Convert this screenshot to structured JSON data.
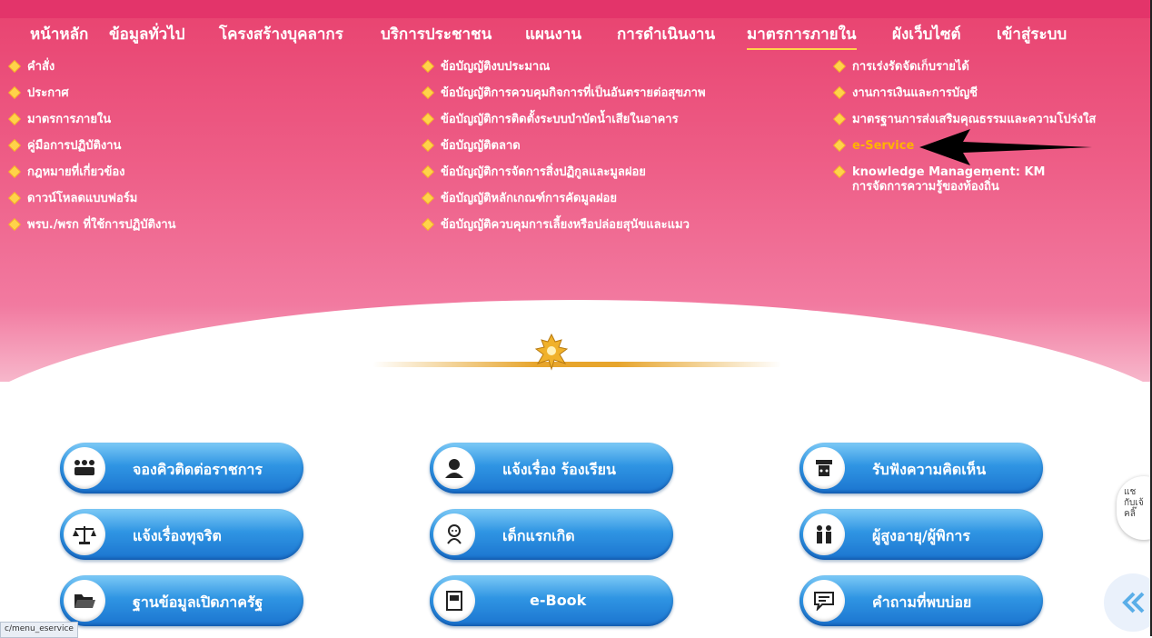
{
  "nav": [
    {
      "label": "หน้าหลัก",
      "active": false
    },
    {
      "label": "ข้อมูลทั่วไป",
      "active": false
    },
    {
      "label": "โครงสร้างบุคลากร",
      "active": false
    },
    {
      "label": "บริการประชาชน",
      "active": false
    },
    {
      "label": "แผนงาน",
      "active": false
    },
    {
      "label": "การดำเนินงาน",
      "active": false
    },
    {
      "label": "มาตรการภายใน",
      "active": true
    },
    {
      "label": "ผังเว็บไซต์",
      "active": false
    },
    {
      "label": "เข้าสู่ระบบ",
      "active": false
    }
  ],
  "submenu": {
    "col1": [
      "คำสั่ง",
      "ประกาศ",
      "มาตรการภายใน",
      "คู่มือการปฏิบัติงาน",
      "กฎหมายที่เกี่ยวข้อง",
      "ดาวน์โหลดแบบฟอร์ม",
      "พรบ./พรก ที่ใช้การปฏิบัติงาน"
    ],
    "col2": [
      "ข้อบัญญัติงบประมาณ",
      "ข้อบัญญัติการควบคุมกิจการที่เป็นอันตรายต่อสุขภาพ",
      "ข้อบัญญัติการติดตั้งระบบบำบัดน้ำเสียในอาคาร",
      "ข้อบัญญัติตลาด",
      "ข้อบัญญัติการจัดการสิ่งปฏิกูลและมูลฝอย",
      "ข้อบัญญัติหลักเกณฑ์การคัดมูลฝอย",
      "ข้อบัญญัติควบคุมการเลี้ยงหรือปล่อยสุนัขและแมว"
    ],
    "col3": [
      "การเร่งรัดจัดเก็บรายได้",
      "งานการเงินและการบัญชี",
      "มาตรฐานการส่งเสริมคุณธรรมและความโปร่งใส",
      "e-Service"
    ],
    "col3_km_line1": "knowledge Management: KM",
    "col3_km_line2": "การจัดการความรู้ของท้องถิ่น"
  },
  "services": [
    {
      "label": "จองคิวติดต่อราชการ",
      "icon": "queue-people-icon"
    },
    {
      "label": "แจ้งเรื่อง ร้องเรียน",
      "icon": "person-complaint-icon"
    },
    {
      "label": "รับฟังความคิดเห็น",
      "icon": "podium-opinion-icon"
    },
    {
      "label": "แจ้งเรื่องทุจริต",
      "icon": "scales-justice-icon"
    },
    {
      "label": "เด็กแรกเกิด",
      "icon": "baby-icon"
    },
    {
      "label": "ผู้สูงอายุ/ผู้พิการ",
      "icon": "elderly-couple-icon"
    },
    {
      "label": "ฐานข้อมูลเปิดภาครัฐ",
      "icon": "open-folder-icon"
    },
    {
      "label": "e-Book",
      "icon": "book-icon"
    },
    {
      "label": "คำถามที่พบบ่อย",
      "icon": "faq-chat-icon"
    }
  ],
  "chat": {
    "line1": "แช",
    "line2": "กับเจ้",
    "line3": "คลิ๊"
  },
  "status_url": "c/menu_eservice",
  "colors": {
    "accent": "#e8426f",
    "highlight": "#ffb300",
    "button": "#2f95e3"
  }
}
